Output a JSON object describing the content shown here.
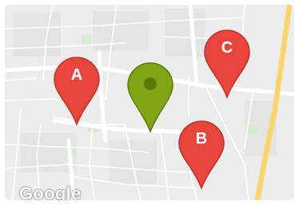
{
  "map": {
    "logo_text": "Google",
    "colors": {
      "land": "#ececec",
      "block": "#e3e3e3",
      "park": "#d6ecd0",
      "road": "#ffffff",
      "highway": "#f9d776",
      "marker_red": "#e8453c",
      "marker_red_dark": "#b7342d",
      "marker_green": "#7fa416",
      "marker_green_dark": "#577a0b"
    },
    "markers": [
      {
        "id": "A",
        "label": "A",
        "color": "marker_red",
        "icon": "map-pin-icon"
      },
      {
        "id": "C",
        "label": "C",
        "color": "marker_red",
        "icon": "map-pin-icon"
      },
      {
        "id": "center",
        "label": "",
        "color": "marker_green",
        "icon": "map-pin-dot-icon"
      },
      {
        "id": "B",
        "label": "B",
        "color": "marker_red",
        "icon": "map-pin-icon"
      }
    ]
  }
}
